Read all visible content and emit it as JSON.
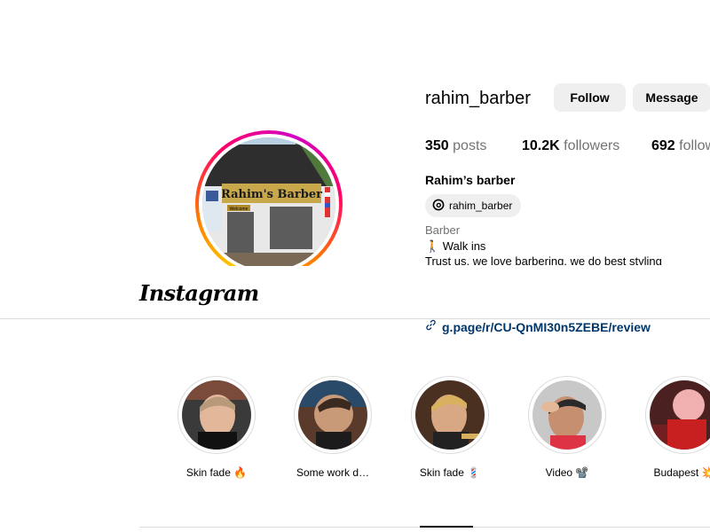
{
  "profile": {
    "username": "rahim_barber",
    "follow_label": "Follow",
    "message_label": "Message",
    "stats": {
      "posts_count": "350",
      "posts_label": "posts",
      "followers_count": "10.2K",
      "followers_label": "followers",
      "following_count": "692",
      "following_label": "following"
    },
    "full_name": "Rahim’s barber",
    "threads_handle": "rahim_barber",
    "category": "Barber",
    "bio_line1": "🚶 Walk ins",
    "bio_line2": "Trust us, we love barbering, we do best styling",
    "link": "g.page/r/CU-QnMI30n5ZEBE/review",
    "avatar_sign_text": "Rahim's Barber",
    "avatar_welcome": "Welcome"
  },
  "header": {
    "logo": "Instagram"
  },
  "highlights": [
    {
      "label": "Skin fade 🔥"
    },
    {
      "label": "Some work d…"
    },
    {
      "label": "Skin fade 💈"
    },
    {
      "label": "Video 📽️"
    },
    {
      "label": "Budapest 💥"
    }
  ],
  "colors": {
    "button_bg": "#efefef",
    "link": "#00376b",
    "muted": "#737373",
    "border": "#dbdbdb"
  }
}
